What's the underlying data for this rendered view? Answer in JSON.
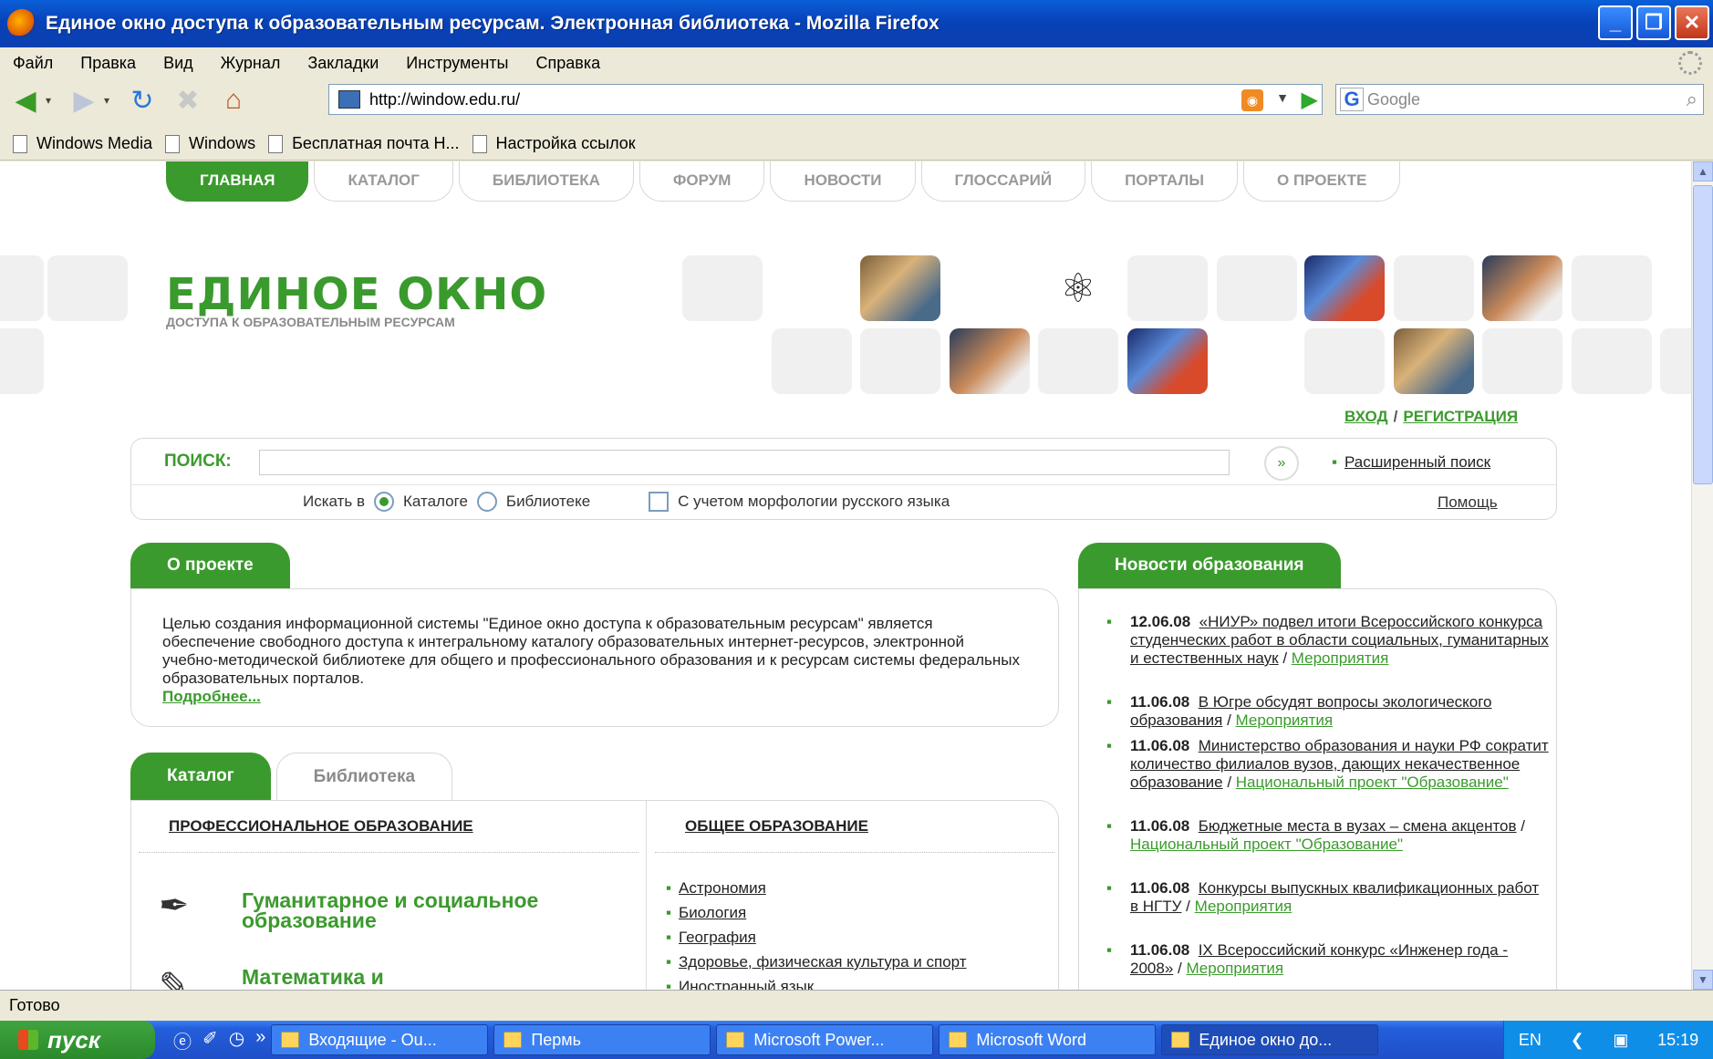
{
  "window": {
    "title": "Единое окно доступа к образовательным ресурсам. Электронная библиотека - Mozilla Firefox"
  },
  "menu": [
    "Файл",
    "Правка",
    "Вид",
    "Журнал",
    "Закладки",
    "Инструменты",
    "Справка"
  ],
  "address": {
    "url": "http://window.edu.ru/",
    "search_placeholder": "Google"
  },
  "bookmarks": [
    "Windows Media",
    "Windows",
    "Бесплатная почта H...",
    "Настройка ссылок"
  ],
  "site": {
    "nav": [
      "ГЛАВНАЯ",
      "КАТАЛОГ",
      "БИБЛИОТЕКА",
      "ФОРУМ",
      "НОВОСТИ",
      "ГЛОССАРИЙ",
      "ПОРТАЛЫ",
      "О ПРОЕКТЕ"
    ],
    "logo_title": "ЕДИНОЕ ОКНО",
    "logo_subtitle": "ДОСТУПА К ОБРАЗОВАТЕЛЬНЫМ РЕСУРСАМ",
    "login": "ВХОД",
    "register": "РЕГИСТРАЦИЯ",
    "search": {
      "label": "ПОИСК:",
      "advanced": "Расширенный поиск",
      "search_in": "Искать в",
      "opt_catalog": "Каталоге",
      "opt_library": "Библиотеке",
      "morphology": "С учетом морфологии русского языка",
      "help": "Помощь"
    },
    "about": {
      "heading": "О проекте",
      "text": "Целью создания информационной системы \"Единое окно доступа к образовательным ресурсам\" является  обеспечение  свободного доступа к интегральному каталогу образовательных интернет-ресурсов, электронной учебно-методической библиотеке для общего и профессионального образования и к ресурсам системы федеральных образовательных порталов.",
      "more": "Подробнее..."
    },
    "tabs": [
      "Каталог",
      "Библиотека"
    ],
    "catalog": {
      "prof_heading": "ПРОФЕССИОНАЛЬНОЕ ОБРАЗОВАНИЕ",
      "general_heading": "ОБЩЕЕ ОБРАЗОВАНИЕ",
      "prof_items": [
        "Гуманитарное и социальное образование",
        "Математика и"
      ],
      "subjects": [
        "Астрономия",
        "Биология",
        "География",
        "Здоровье, физическая культура и спорт",
        "Иностранный язык"
      ]
    },
    "news": {
      "heading": "Новости образования",
      "items": [
        {
          "date": "12.06.08",
          "text": "«НИУР» подвел итоги Всероссийского конкурса студенческих работ в области социальных, гуманитарных и естественных наук",
          "category": "Мероприятия"
        },
        {
          "date": "11.06.08",
          "text": "В Югре обсудят вопросы экологического образования",
          "category": "Мероприятия"
        },
        {
          "date": "11.06.08",
          "text": "Министерство образования и науки РФ сократит количество филиалов вузов, дающих некачественное образование",
          "category": "Национальный проект \"Образование\""
        },
        {
          "date": "11.06.08",
          "text": "Бюджетные места в вузах – смена акцентов",
          "category": "Национальный проект \"Образование\""
        },
        {
          "date": "11.06.08",
          "text": "Конкурсы выпускных квалификационных работ в НГТУ",
          "category": "Мероприятия"
        },
        {
          "date": "11.06.08",
          "text": "IX Всероссийский конкурс «Инженер года - 2008»",
          "category": "Мероприятия"
        }
      ]
    }
  },
  "status": "Готово",
  "taskbar": {
    "start": "пуск",
    "tasks": [
      "Входящие - Ou...",
      "Пермь",
      "Microsoft Power...",
      "Microsoft Word",
      "Единое окно до..."
    ],
    "lang": "EN",
    "clock": "15:19"
  }
}
